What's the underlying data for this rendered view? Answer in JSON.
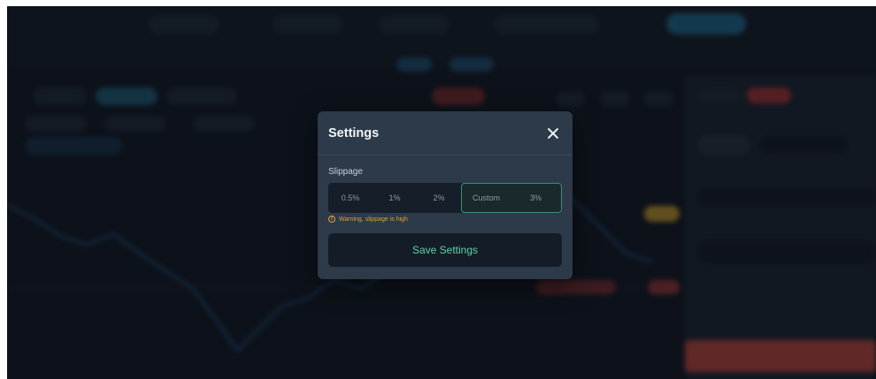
{
  "modal": {
    "title": "Settings",
    "slippage_label": "Slippage",
    "options": [
      "0.5%",
      "1%",
      "2%"
    ],
    "custom_label": "Custom",
    "custom_value": "3%",
    "warning": "Warning, slippage is high",
    "warning_icon": "info-circle-icon",
    "save_label": "Save Settings"
  },
  "colors": {
    "accent": "#5fd3a5",
    "warning": "#e0a03a",
    "custom_border": "#3d8f74"
  }
}
